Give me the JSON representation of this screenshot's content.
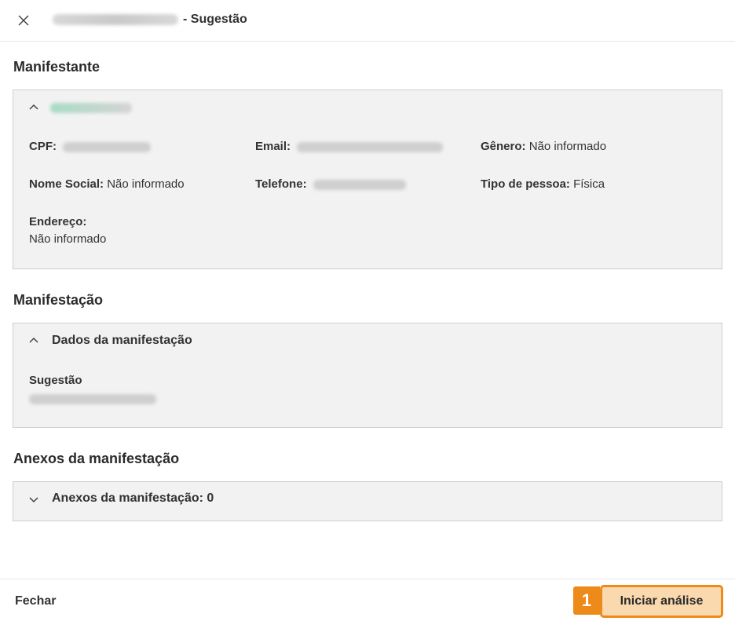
{
  "header": {
    "title_suffix": "- Sugestão",
    "close_icon": "close-icon"
  },
  "manifestante": {
    "section_title": "Manifestante",
    "fields": {
      "cpf_label": "CPF:",
      "email_label": "Email:",
      "genero_label": "Gênero:",
      "genero_value": "Não informado",
      "nome_social_label": "Nome Social:",
      "nome_social_value": "Não informado",
      "telefone_label": "Telefone:",
      "tipo_pessoa_label": "Tipo de pessoa:",
      "tipo_pessoa_value": "Física",
      "endereco_label": "Endereço:",
      "endereco_value": "Não informado"
    }
  },
  "manifestacao": {
    "section_title": "Manifestação",
    "panel_title": "Dados da manifestação",
    "type_label": "Sugestão"
  },
  "anexos": {
    "section_title": "Anexos da manifestação",
    "panel_title": "Anexos da manifestação: 0"
  },
  "footer": {
    "close_label": "Fechar",
    "step_number": "1",
    "primary_label": "Iniciar análise"
  },
  "colors": {
    "accent": "#ee8a1a",
    "button_fill": "#fbd9ae",
    "panel_bg": "#f2f2f2"
  }
}
